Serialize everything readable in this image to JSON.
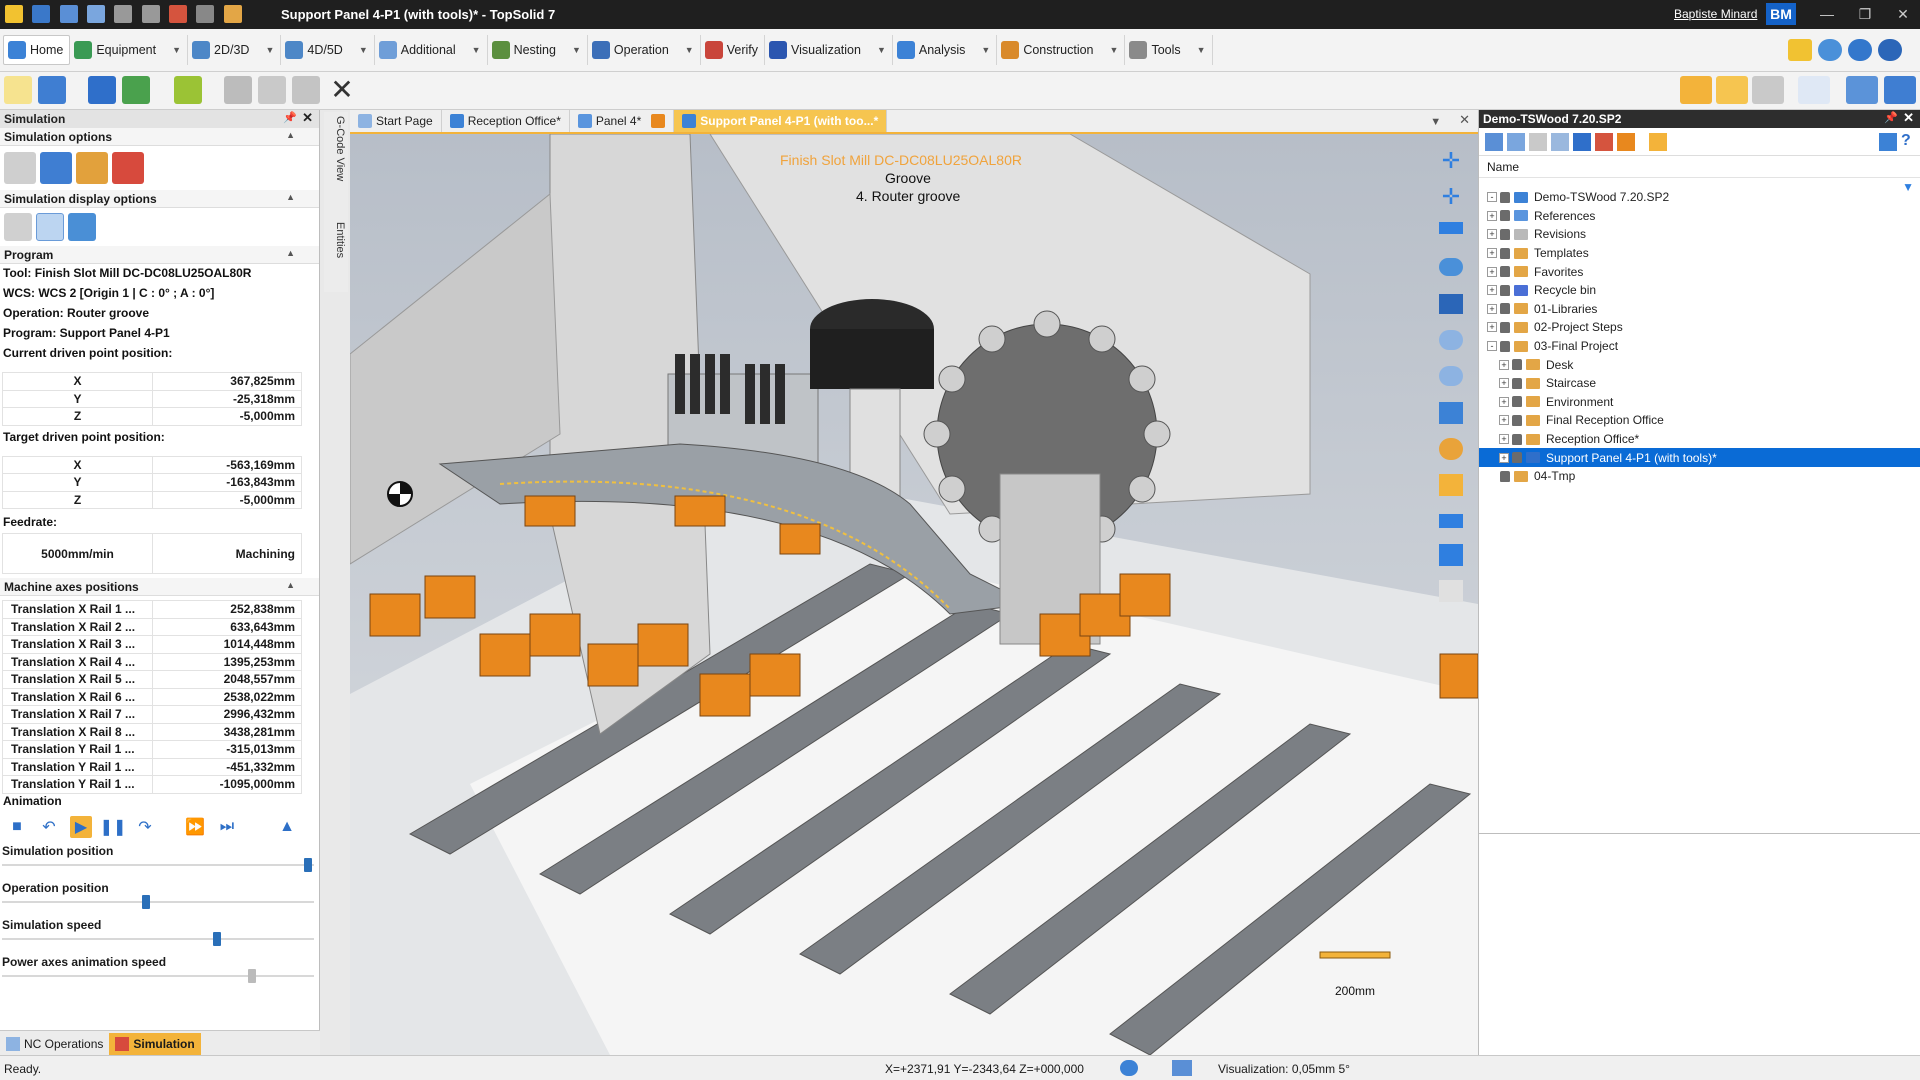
{
  "window": {
    "title": "Support Panel 4-P1 (with tools)* - TopSolid 7",
    "user": "Baptiste Minard",
    "user_initials": "BM"
  },
  "menu": [
    {
      "label": "Home",
      "active": true
    },
    {
      "label": "Equipment"
    },
    {
      "label": "2D/3D"
    },
    {
      "label": "4D/5D"
    },
    {
      "label": "Additional"
    },
    {
      "label": "Nesting"
    },
    {
      "label": "Operation"
    },
    {
      "label": "Verify"
    },
    {
      "label": "Visualization"
    },
    {
      "label": "Analysis"
    },
    {
      "label": "Construction"
    },
    {
      "label": "Tools"
    }
  ],
  "left_panel": {
    "title": "Simulation",
    "sim_options_label": "Simulation options",
    "sim_display_label": "Simulation display options",
    "program_label": "Program",
    "tool": "Tool: Finish Slot Mill DC-DC08LU25OAL80R",
    "wcs": "WCS: WCS 2 [Origin 1 | C : 0° ; A : 0°]",
    "operation": "Operation: Router groove",
    "program": "Program: Support Panel 4-P1",
    "current_label": "Current driven point position:",
    "current": [
      {
        "axis": "X",
        "value": "367,825mm"
      },
      {
        "axis": "Y",
        "value": "-25,318mm"
      },
      {
        "axis": "Z",
        "value": "-5,000mm"
      }
    ],
    "target_label": "Target driven point position:",
    "target": [
      {
        "axis": "X",
        "value": "-563,169mm"
      },
      {
        "axis": "Y",
        "value": "-163,843mm"
      },
      {
        "axis": "Z",
        "value": "-5,000mm"
      }
    ],
    "feedrate_label": "Feedrate:",
    "feedrate_value": "5000mm/min",
    "feedrate_mode": "Machining",
    "machine_axes_label": "Machine axes positions",
    "axes": [
      {
        "name": "Translation X Rail 1 ...",
        "value": "252,838mm"
      },
      {
        "name": "Translation X Rail 2 ...",
        "value": "633,643mm"
      },
      {
        "name": "Translation X Rail 3 ...",
        "value": "1014,448mm"
      },
      {
        "name": "Translation X Rail 4 ...",
        "value": "1395,253mm"
      },
      {
        "name": "Translation X Rail 5 ...",
        "value": "2048,557mm"
      },
      {
        "name": "Translation X Rail 6 ...",
        "value": "2538,022mm"
      },
      {
        "name": "Translation X Rail 7 ...",
        "value": "2996,432mm"
      },
      {
        "name": "Translation X Rail 8 ...",
        "value": "3438,281mm"
      },
      {
        "name": "Translation Y Rail 1 ...",
        "value": "-315,013mm"
      },
      {
        "name": "Translation Y Rail 1 ...",
        "value": "-451,332mm"
      },
      {
        "name": "Translation Y Rail 1 ...",
        "value": "-1095,000mm"
      }
    ],
    "animation_label": "Animation",
    "sliders": [
      {
        "label": "Simulation position",
        "level": 0.98
      },
      {
        "label": "Operation position",
        "level": 0.46
      },
      {
        "label": "Simulation speed",
        "level": 0.69
      },
      {
        "label": "Power axes animation speed",
        "level": 0.8
      }
    ],
    "bottom_tabs": [
      "NC Operations",
      "Simulation"
    ]
  },
  "side_tabs": [
    "G-Code View",
    "Entities"
  ],
  "doc_tabs": [
    {
      "label": "Start Page"
    },
    {
      "label": "Reception Office*"
    },
    {
      "label": "Panel 4*"
    },
    {
      "label": "Support Panel 4-P1 (with too...*",
      "active": true
    }
  ],
  "viewport": {
    "tool_text": "Finish Slot Mill DC-DC08LU25OAL80R",
    "op_text": "Groove",
    "op_name": "4. Router groove",
    "scale_label": "200mm"
  },
  "right_panel": {
    "title": "Demo-TSWood 7.20.SP2",
    "column_header": "Name",
    "tree": [
      {
        "label": "Demo-TSWood 7.20.SP2",
        "depth": 0,
        "exp": "-",
        "icon": "project"
      },
      {
        "label": "References",
        "depth": 0,
        "exp": "+",
        "icon": "ref"
      },
      {
        "label": "Revisions",
        "depth": 0,
        "exp": "+",
        "icon": "rev"
      },
      {
        "label": "Templates",
        "depth": 0,
        "exp": "+",
        "icon": "folder"
      },
      {
        "label": "Favorites",
        "depth": 0,
        "exp": "+",
        "icon": "folder"
      },
      {
        "label": "Recycle bin",
        "depth": 0,
        "exp": "+",
        "icon": "bin"
      },
      {
        "label": "01-Libraries",
        "depth": 0,
        "exp": "+",
        "icon": "folder"
      },
      {
        "label": "02-Project Steps",
        "depth": 0,
        "exp": "+",
        "icon": "folder"
      },
      {
        "label": "03-Final Project",
        "depth": 0,
        "exp": "-",
        "icon": "folder"
      },
      {
        "label": "Desk",
        "depth": 1,
        "exp": "+",
        "icon": "folder"
      },
      {
        "label": "Staircase",
        "depth": 1,
        "exp": "+",
        "icon": "folder"
      },
      {
        "label": "Environment",
        "depth": 1,
        "exp": "+",
        "icon": "folder"
      },
      {
        "label": "Final Reception Office",
        "depth": 1,
        "exp": "+",
        "icon": "folder"
      },
      {
        "label": "Reception Office*",
        "depth": 1,
        "exp": "+",
        "icon": "folder"
      },
      {
        "label": "Support Panel 4-P1 (with tools)*",
        "depth": 1,
        "exp": "+",
        "icon": "doc",
        "selected": true
      },
      {
        "label": "04-Tmp",
        "depth": 0,
        "exp": "",
        "icon": "folder"
      }
    ]
  },
  "status": {
    "text": "Ready.",
    "coords": "X=+2371,91  Y=-2343,64  Z=+000,000",
    "visualization": "Visualization: 0,05mm 5°"
  },
  "colors": {
    "accent": "#f3b33a",
    "selection": "#0a6bd6",
    "titlebar": "#1f1f1f",
    "machine_orange": "#e8881e"
  }
}
